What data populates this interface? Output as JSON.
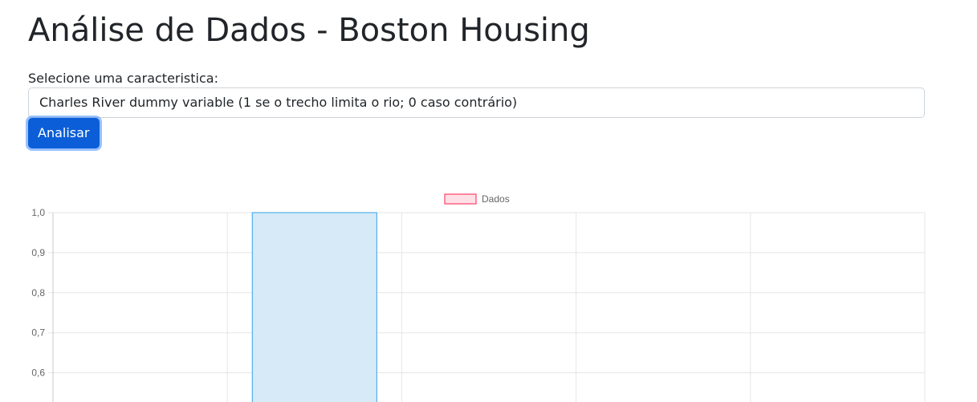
{
  "page": {
    "title": "Análise de Dados - Boston Housing"
  },
  "form": {
    "select_label": "Selecione uma caracteristica:",
    "selected_option": "Charles River dummy variable (1 se o trecho limita o rio; 0 caso contrário)",
    "analyze_button": "Analisar"
  },
  "colors": {
    "button": "#0b5ed7",
    "bar_fill": "#d6eaf8",
    "bar_stroke": "#36a2eb",
    "legend_fill": "#ffe0e6",
    "legend_stroke": "#ff6384",
    "grid": "#e5e5e5"
  },
  "chart_data": {
    "type": "bar",
    "legend": [
      "Dados"
    ],
    "y_ticks": [
      "1,0",
      "0,9",
      "0,8",
      "0,7",
      "0,6"
    ],
    "ylim_visible": [
      0.55,
      1.0
    ],
    "category_count": 5,
    "series": [
      {
        "name": "Dados",
        "values": [
          null,
          1.0,
          null,
          null,
          null
        ]
      }
    ],
    "grid": true,
    "legend_position": "top"
  }
}
